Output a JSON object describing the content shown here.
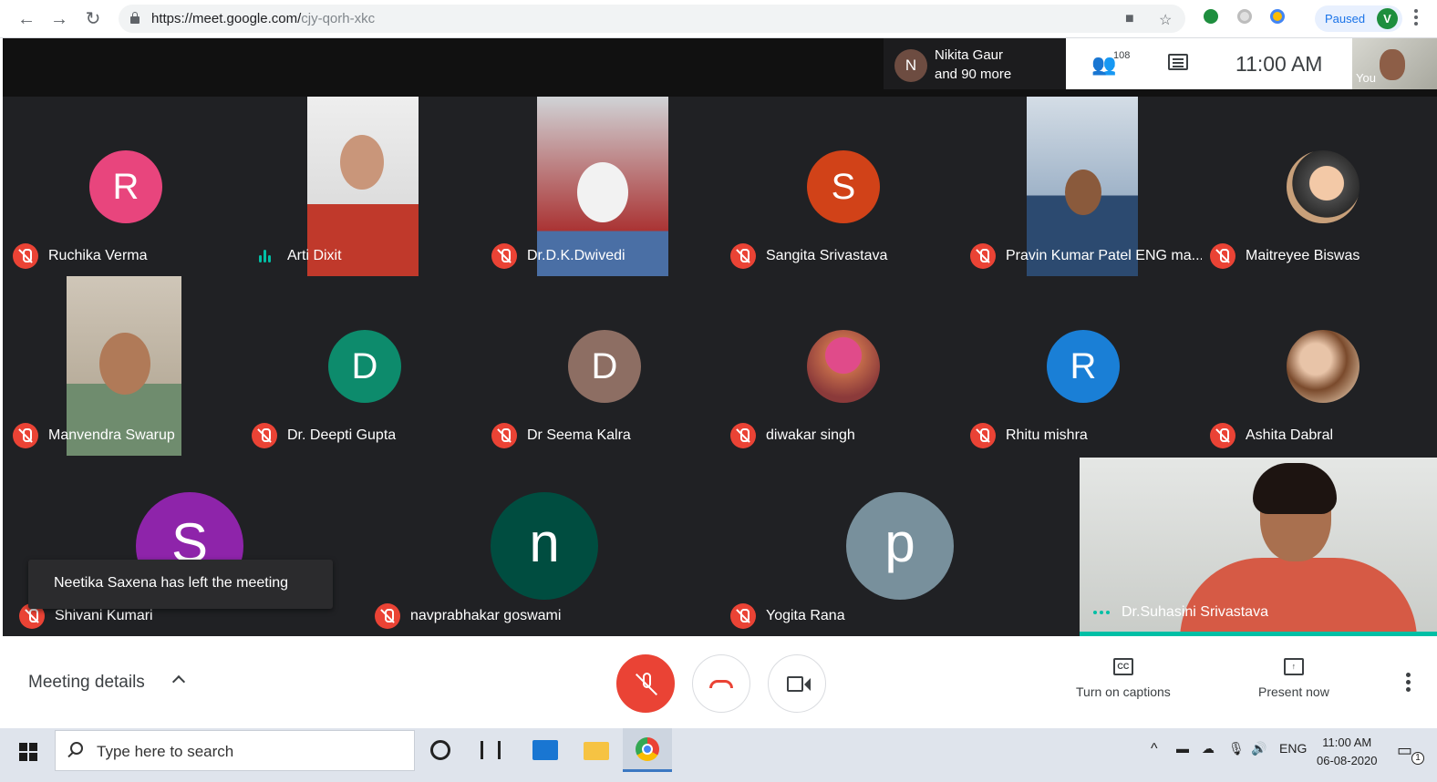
{
  "browser": {
    "url_host": "https://meet.google.com/",
    "url_path": "cjy-qorh-xkc",
    "profile_status": "Paused",
    "profile_initial": "V",
    "icons": [
      "back-icon",
      "forward-icon",
      "reload-icon",
      "lock-icon",
      "camera-icon",
      "star-icon",
      "extension-icon",
      "kebab-icon"
    ]
  },
  "meet_header": {
    "presenter_initial": "N",
    "presenter_line1": "Nikita Gaur",
    "presenter_line2": "and 90 more",
    "people_count": "108",
    "time": "11:00  AM",
    "self_label": "You"
  },
  "participants": [
    {
      "name": "Ruchika Verma",
      "initial": "R",
      "color": "#e8457d",
      "state": "muted",
      "type": "avatar"
    },
    {
      "name": "Arti Dixit",
      "state": "speaking",
      "type": "video"
    },
    {
      "name": "Dr.D.K.Dwivedi",
      "state": "muted",
      "type": "video"
    },
    {
      "name": "Sangita Srivastava",
      "initial": "S",
      "color": "#d14218",
      "state": "muted",
      "type": "avatar"
    },
    {
      "name": "Pravin Kumar Patel ENG ma...",
      "state": "muted",
      "type": "video"
    },
    {
      "name": "Maitreyee Biswas",
      "state": "muted",
      "type": "photo"
    },
    {
      "name": "Manvendra Swarup",
      "state": "muted",
      "type": "video"
    },
    {
      "name": "Dr. Deepti Gupta",
      "initial": "D",
      "color": "#0d8b6c",
      "state": "muted",
      "type": "avatar"
    },
    {
      "name": "Dr Seema Kalra",
      "initial": "D",
      "color": "#8d6e63",
      "state": "muted",
      "type": "avatar"
    },
    {
      "name": "diwakar singh",
      "state": "muted",
      "type": "photo"
    },
    {
      "name": "Rhitu mishra",
      "initial": "R",
      "color": "#1a7fd6",
      "state": "muted",
      "type": "avatar"
    },
    {
      "name": "Ashita Dabral",
      "state": "muted",
      "type": "photo"
    },
    {
      "name": "Shivani Kumari",
      "initial": "S",
      "color": "#8e24aa",
      "state": "muted",
      "type": "avatar"
    },
    {
      "name": "navprabhakar goswami",
      "initial": "n",
      "color": "#004d40",
      "state": "muted",
      "type": "avatar"
    },
    {
      "name": "Yogita Rana",
      "initial": "p",
      "color": "#78909c",
      "state": "muted",
      "type": "avatar"
    }
  ],
  "main_speaker": {
    "name": "Dr.Suhasini Srivastava"
  },
  "toast": "Neetika Saxena has left the meeting",
  "controls": {
    "meeting_details": "Meeting details",
    "captions_label": "Turn on captions",
    "captions_icon_text": "CC",
    "present_label": "Present now"
  },
  "taskbar": {
    "search_placeholder": "Type here to search",
    "language": "ENG",
    "time": "11:00 AM",
    "date": "06-08-2020",
    "notification_count": "1"
  }
}
